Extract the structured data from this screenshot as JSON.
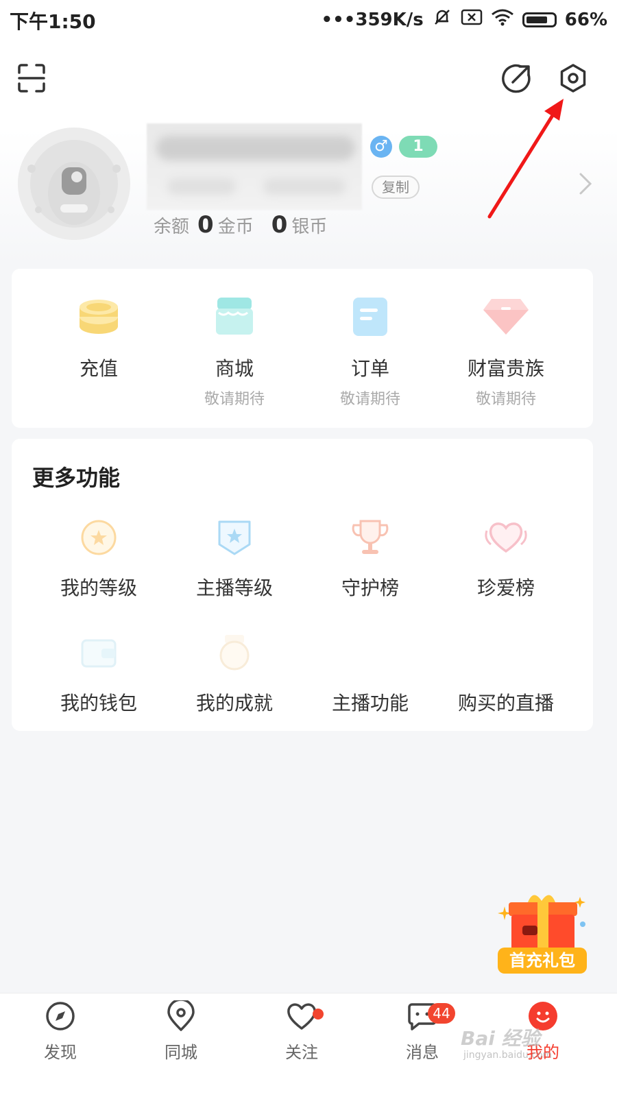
{
  "status_bar": {
    "time": "下午1:50",
    "network_speed": "•••359K/s",
    "battery": "66%"
  },
  "header": {
    "icons": [
      "scan-icon",
      "share-icon",
      "settings-icon"
    ]
  },
  "profile": {
    "level": "1",
    "gender_symbol": "♂",
    "copy_label": "复制",
    "balance_label": "余额",
    "gold_value": "0",
    "gold_unit": "金币",
    "silver_value": "0",
    "silver_unit": "银币"
  },
  "top_card": {
    "items": [
      {
        "label": "充值",
        "sub": ""
      },
      {
        "label": "商城",
        "sub": "敬请期待"
      },
      {
        "label": "订单",
        "sub": "敬请期待"
      },
      {
        "label": "财富贵族",
        "sub": "敬请期待"
      }
    ]
  },
  "more": {
    "title": "更多功能",
    "items": [
      {
        "label": "我的等级"
      },
      {
        "label": "主播等级"
      },
      {
        "label": "守护榜"
      },
      {
        "label": "珍爱榜"
      },
      {
        "label": "我的钱包"
      },
      {
        "label": "我的成就"
      },
      {
        "label": "主播功能"
      },
      {
        "label": "购买的直播"
      }
    ]
  },
  "gift": {
    "label": "首充礼包"
  },
  "bottom_nav": {
    "items": [
      {
        "label": "发现"
      },
      {
        "label": "同城"
      },
      {
        "label": "关注"
      },
      {
        "label": "消息",
        "badge": "44"
      },
      {
        "label": "我的"
      }
    ]
  },
  "watermark": {
    "text": "Bai 经验",
    "sub": "jingyan.baidu.com"
  },
  "colors": {
    "accent": "#f53c2e",
    "arrow": "#f01818",
    "badge": "#f2452f"
  }
}
